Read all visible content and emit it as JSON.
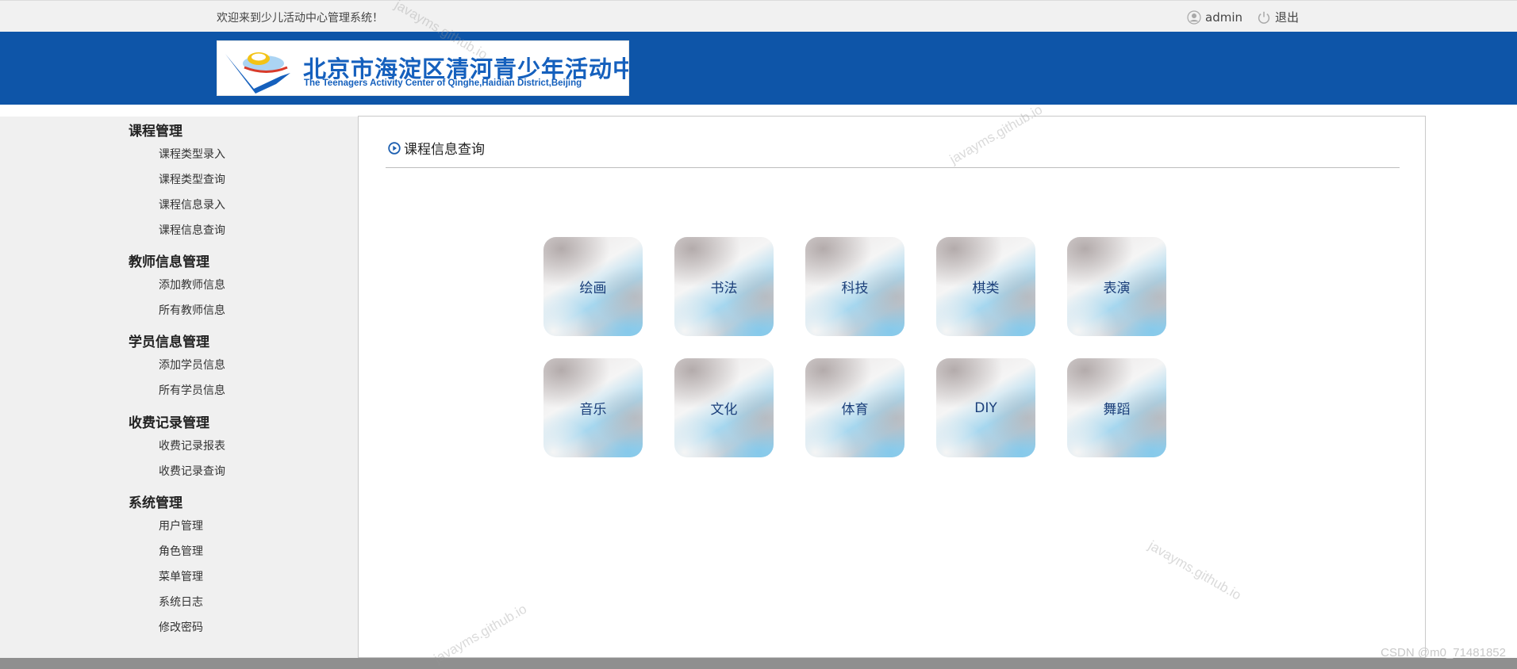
{
  "topbar": {
    "welcome": "欢迎来到少儿活动中心管理系统！",
    "username": "admin",
    "logout_label": "退出"
  },
  "header": {
    "logo_cn": "北京市海淀区清河青少年活动中心",
    "logo_en": "The Teenagers Activity Center of Qinghe,Haidian District,Beijing",
    "background_color": "#0e55a8"
  },
  "sidebar": {
    "groups": [
      {
        "title": "课程管理",
        "items": [
          "课程类型录入",
          "课程类型查询",
          "课程信息录入",
          "课程信息查询"
        ]
      },
      {
        "title": "教师信息管理",
        "items": [
          "添加教师信息",
          "所有教师信息"
        ]
      },
      {
        "title": "学员信息管理",
        "items": [
          "添加学员信息",
          "所有学员信息"
        ]
      },
      {
        "title": "收费记录管理",
        "items": [
          "收费记录报表",
          "收费记录查询"
        ]
      },
      {
        "title": "系统管理",
        "items": [
          "用户管理",
          "角色管理",
          "菜单管理",
          "系统日志",
          "修改密码"
        ]
      }
    ]
  },
  "main": {
    "title": "课程信息查询",
    "tiles": [
      "绘画",
      "书法",
      "科技",
      "棋类",
      "表演",
      "音乐",
      "文化",
      "体育",
      "DIY",
      "舞蹈"
    ]
  },
  "watermarks": [
    "javayms.github.io",
    "javayms.github.io",
    "javayms.github.io",
    "javayms.github.io"
  ],
  "footer_credit": "CSDN @m0_71481852"
}
